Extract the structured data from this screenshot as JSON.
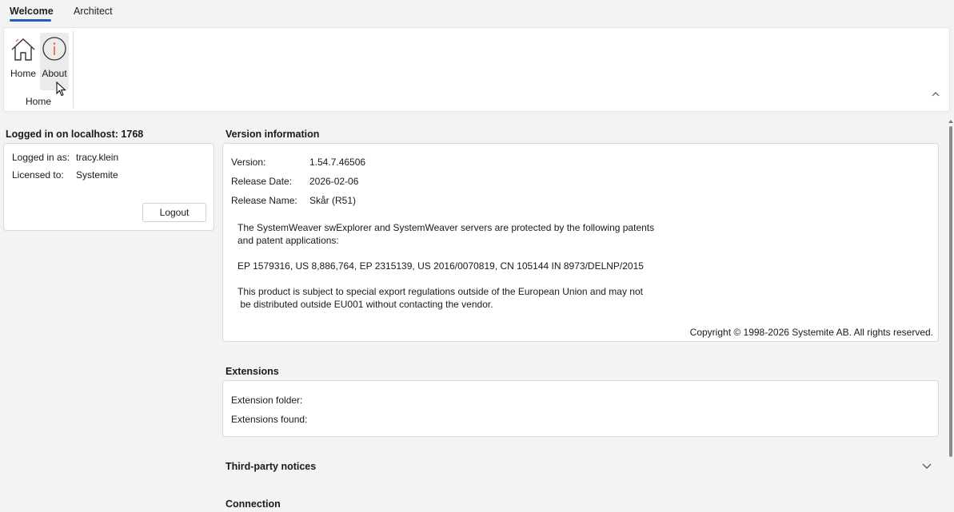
{
  "tabs": [
    {
      "label": "Welcome",
      "active": true
    },
    {
      "label": "Architect",
      "active": false
    }
  ],
  "ribbon": {
    "home_button": {
      "label": "Home",
      "icon": "house-icon"
    },
    "about_button": {
      "label": "About",
      "icon": "info-circle-icon"
    },
    "group_label": "Home",
    "collapse_icon": "chevron-up-icon"
  },
  "login": {
    "title": "Logged in on localhost: 1768",
    "logged_in_as_label": "Logged in as:",
    "logged_in_as_value": "tracy.klein",
    "licensed_to_label": "Licensed to:",
    "licensed_to_value": "Systemite",
    "logout_label": "Logout"
  },
  "version_info": {
    "title": "Version information",
    "version_label": "Version:",
    "version_value": "1.54.7.46506",
    "release_date_label": "Release Date:",
    "release_date_value": "2026-02-06",
    "release_name_label": "Release Name:",
    "release_name_value": "Skår (R51)",
    "patent_text_1": "The SystemWeaver swExplorer and SystemWeaver servers are protected by the following patents",
    "patent_text_2": "and patent applications:",
    "patents": "EP 1579316, US 8,886,764, EP 2315139, US 2016/0070819, CN 105144 IN 8973/DELNP/2015",
    "export_text_1": "This product is subject to special export regulations outside of the European Union and may not",
    "export_text_2": " be distributed outside EU001 without contacting the vendor.",
    "copyright": "Copyright © 1998-2026 Systemite AB. All rights reserved."
  },
  "extensions": {
    "title": "Extensions",
    "folder_label": "Extension folder:",
    "found_label": "Extensions found:"
  },
  "third_party": {
    "title": "Third-party notices",
    "expand_icon": "chevron-down-icon"
  },
  "connection": {
    "title": "Connection"
  },
  "colors": {
    "accent": "#1f5fbf",
    "info_icon": "#e8603c"
  }
}
